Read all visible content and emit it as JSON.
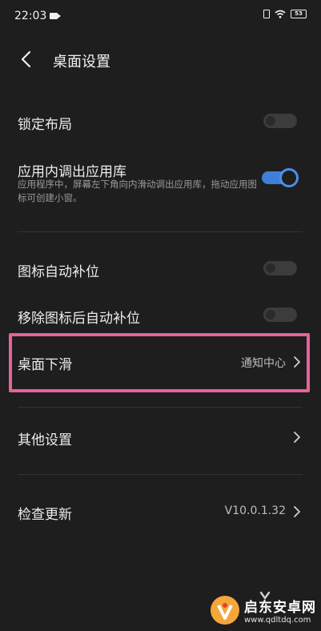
{
  "status_bar": {
    "time": "22:03",
    "battery": "53"
  },
  "header": {
    "title": "桌面设置"
  },
  "settings": {
    "lock_layout": {
      "label": "锁定布局",
      "enabled": false
    },
    "app_library": {
      "label": "应用内调出应用库",
      "description": "应用程序中，屏幕左下角向内滑动调出应用库，拖动应用图标可创建小窗。",
      "enabled": true
    },
    "auto_fill_icons": {
      "label": "图标自动补位",
      "enabled": false
    },
    "auto_fill_after_remove": {
      "label": "移除图标后自动补位",
      "enabled": false
    },
    "desktop_swipe_down": {
      "label": "桌面下滑",
      "value": "通知中心"
    },
    "other_settings": {
      "label": "其他设置"
    },
    "check_update": {
      "label": "检查更新",
      "value": "V10.0.1.32"
    }
  },
  "watermark": {
    "title": "启东安卓网",
    "url": "www.qdltdq.com"
  },
  "colors": {
    "accent": "#3f7fd8",
    "highlight": "#e4649a",
    "background": "#1e1e1e"
  }
}
